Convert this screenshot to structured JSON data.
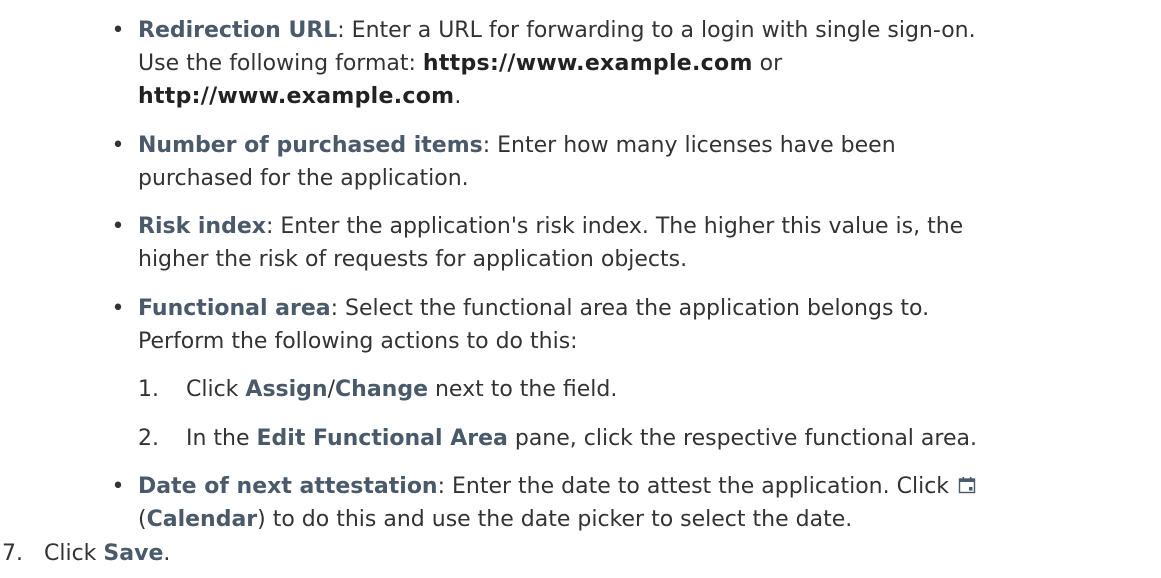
{
  "bullets": {
    "redirection": {
      "term": "Redirection URL",
      "text1": ": Enter a URL for forwarding to a login with single sign-on.",
      "text2": "Use the following format: ",
      "format1": "https://www.example.com",
      "or": " or",
      "format2": "http://www.example.com",
      "end": "."
    },
    "purchased": {
      "term": "Number of purchased items",
      "text1": ": Enter how many licenses have been",
      "text2": "purchased for the application."
    },
    "risk": {
      "term": "Risk index",
      "text1": ": Enter the application's risk index. The higher this value is, the",
      "text2": "higher the risk of requests for application objects."
    },
    "functional": {
      "term": "Functional area",
      "text1": ": Select the functional area the application belongs to.",
      "text2": "Perform the following actions to do this:",
      "steps": [
        {
          "num": "1.",
          "pre": "Click ",
          "b1": "Assign",
          "sep": "/",
          "b2": "Change",
          "post": " next to the field."
        },
        {
          "num": "2.",
          "pre": "In the ",
          "b1": "Edit Functional Area",
          "post": " pane, click the respective functional area."
        }
      ]
    },
    "attestation": {
      "term": "Date of next attestation",
      "text1": ": Enter the date to attest the application. Click",
      "icon": "calendar-icon",
      "text2a": "(",
      "calendar": "Calendar",
      "text2b": ") to do this and use the date picker to select the date."
    }
  },
  "bullet_symbol": "•",
  "step7": {
    "num": "7.",
    "pre": "Click ",
    "b": "Save",
    "post": "."
  }
}
